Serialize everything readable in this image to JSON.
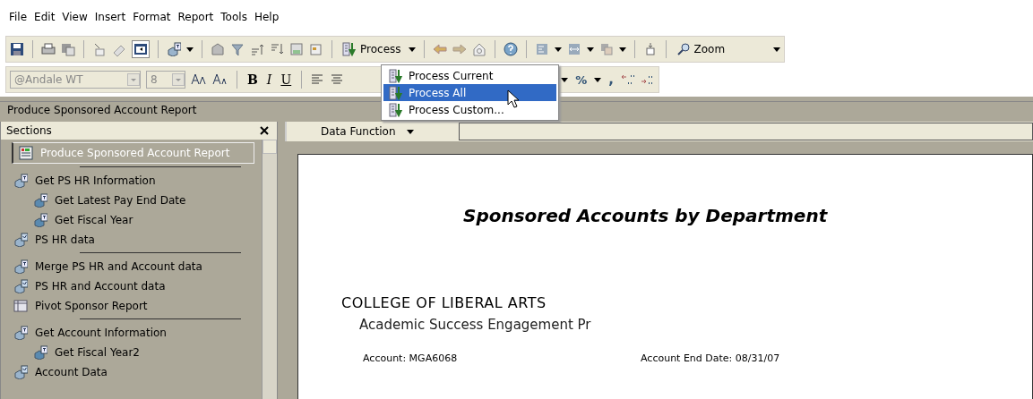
{
  "menu_bar": [
    "File",
    "Edit",
    "View",
    "Insert",
    "Format",
    "Report",
    "Tools",
    "Help"
  ],
  "toolbar": {
    "layout_toggle": {
      "pressed": true
    },
    "process_label": "Process",
    "zoom_label": "Zoom"
  },
  "format_bar": {
    "font": "@Andale WT",
    "size": "8",
    "bold": "B",
    "italic": "I",
    "underline": "U",
    "percent": "%",
    "comma": ","
  },
  "process_menu": [
    {
      "label": "Process Current",
      "selected": false
    },
    {
      "label": "Process All",
      "selected": true
    },
    {
      "label": "Process Custom...",
      "selected": false
    }
  ],
  "panel_title": "Produce Sponsored Account Report",
  "sections": {
    "title": "Sections",
    "items": [
      {
        "label": "Produce Sponsored Account Report",
        "kind": "report",
        "selected": true,
        "divider_after": true
      },
      {
        "label": "Get PS HR Information",
        "kind": "query",
        "selected": false,
        "divider_after": false,
        "children": [
          {
            "label": "Get Latest Pay End Date",
            "kind": "subquery",
            "selected": false,
            "divider_after": false
          },
          {
            "label": "Get Fiscal Year",
            "kind": "subquery",
            "selected": false,
            "divider_after": false
          }
        ]
      },
      {
        "label": "PS HR data",
        "kind": "results",
        "selected": false,
        "divider_after": true
      },
      {
        "label": "Merge PS HR and Account data",
        "kind": "query",
        "selected": false,
        "divider_after": false
      },
      {
        "label": "PS HR and Account data",
        "kind": "results",
        "selected": false,
        "divider_after": false
      },
      {
        "label": "Pivot Sponsor Report",
        "kind": "pivot",
        "selected": false,
        "divider_after": true
      },
      {
        "label": "Get Account Information",
        "kind": "query",
        "selected": false,
        "divider_after": false,
        "children": [
          {
            "label": "Get Fiscal Year2",
            "kind": "subquery",
            "selected": false,
            "divider_after": false
          }
        ]
      },
      {
        "label": "Account Data",
        "kind": "results",
        "selected": false,
        "divider_after": false
      }
    ]
  },
  "data_function": {
    "label": "Data Function"
  },
  "report": {
    "title": "Sponsored Accounts by Department",
    "college": "COLLEGE OF LIBERAL ARTS",
    "program": "Academic Success Engagement Pr",
    "account": "Account: MGA6068",
    "end_date": "Account End Date: 08/31/07"
  }
}
